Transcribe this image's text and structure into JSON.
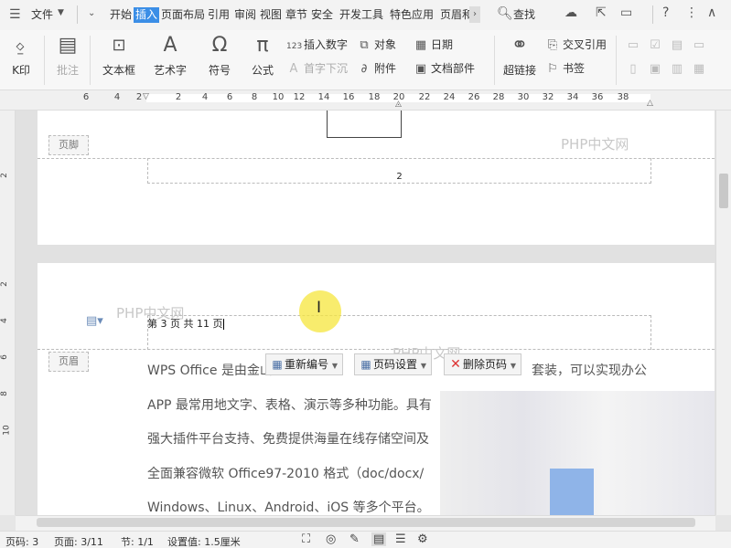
{
  "menubar": {
    "file_label": "文件",
    "tabs": [
      "开始",
      "插入",
      "页面布局",
      "引用",
      "审阅",
      "视图",
      "章节",
      "安全",
      "开发工具",
      "特色应用",
      "页眉和"
    ],
    "active_tab": "插入",
    "search_label": "查找"
  },
  "ribbon": {
    "left_partial": "K印",
    "comment": "批注",
    "textbox": "文本框",
    "wordart": "艺术字",
    "symbol": "符号",
    "formula": "公式",
    "insert_number": "插入数字",
    "object": "对象",
    "date": "日期",
    "dropcap": "首字下沉",
    "attachment": "附件",
    "doc_parts": "文档部件",
    "hyperlink": "超链接",
    "crossref": "交叉引用",
    "bookmark": "书签"
  },
  "ruler": {
    "numbers": [
      "6",
      "4",
      "2",
      "2",
      "4",
      "6",
      "8",
      "10",
      "12",
      "14",
      "16",
      "18",
      "20",
      "22",
      "24",
      "26",
      "28",
      "30",
      "32",
      "34",
      "36",
      "38"
    ]
  },
  "vruler": {
    "numbers": [
      "2",
      "2",
      "4",
      "6",
      "8",
      "10"
    ]
  },
  "document": {
    "footer_tag": "页脚",
    "header_tag": "页眉",
    "page_number": "2",
    "header_text": "第 3 页 共 11 页",
    "watermark": "PHP中文网",
    "body_lines": [
      "WPS Office 是由金山",
      "APP 最常用地文字、表格、演示等多种功能。具有",
      "强大插件平台支持、免费提供海量在线存储空间及",
      "全面兼容微软 Office97-2010 格式（doc/docx/",
      "Windows、Linux、Android、iOS 等多个平台。"
    ],
    "body_line1_tail": "套装，可以实现办公"
  },
  "float_toolbar": {
    "renumber": "重新编号",
    "page_setting": "页码设置",
    "delete_page_number": "删除页码"
  },
  "statusbar": {
    "page_code": "页码: 3",
    "page": "页面: 3/11",
    "section": "节: 1/1",
    "setting": "设置值: 1.5厘米"
  }
}
